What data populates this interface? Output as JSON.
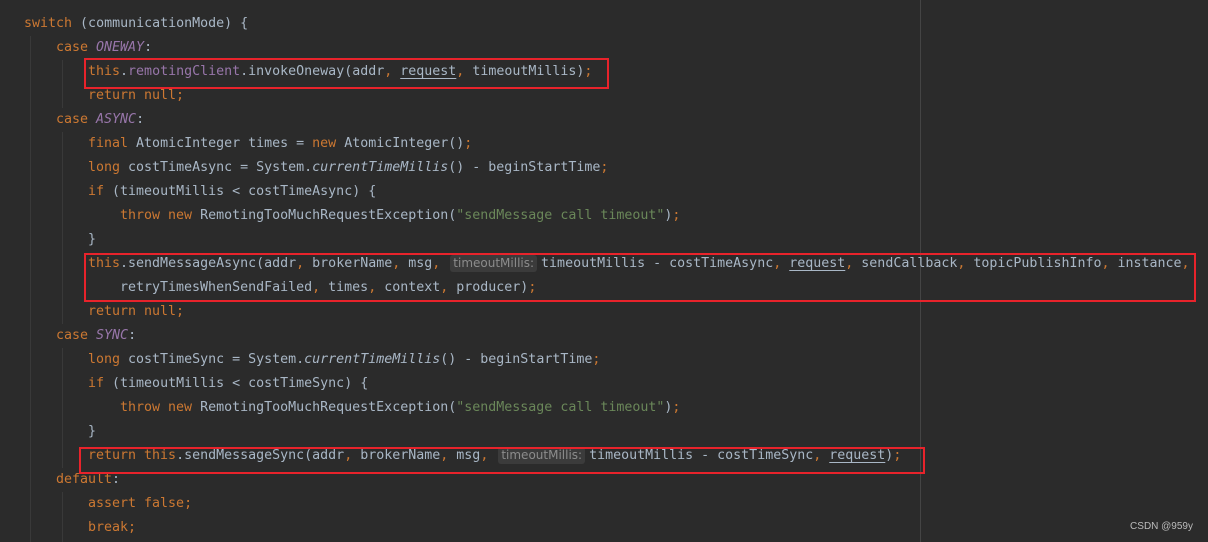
{
  "colors": {
    "background": "#2b2b2b",
    "keyword": "#cc7832",
    "constant": "#9876aa",
    "string": "#6a8759",
    "text": "#a9b7c6",
    "highlight_box": "#e8232b"
  },
  "code": {
    "lines": [
      {
        "indent": 0,
        "tokens": [
          [
            "switch",
            "kw"
          ],
          [
            " (communicationMode) {",
            ""
          ]
        ]
      },
      {
        "indent": 1,
        "tokens": [
          [
            "case ",
            "kw"
          ],
          [
            "ONEWAY",
            "const"
          ],
          [
            ":",
            ""
          ]
        ]
      },
      {
        "indent": 2,
        "tokens": [
          [
            "this",
            "kw"
          ],
          [
            ".",
            ""
          ],
          [
            "remotingClient",
            "field"
          ],
          [
            ".invokeOneway(addr",
            ""
          ],
          [
            ", ",
            "kw"
          ],
          [
            "request",
            "ul"
          ],
          [
            ", ",
            "kw"
          ],
          [
            "timeoutMillis)",
            ""
          ],
          [
            ";",
            "kw"
          ]
        ]
      },
      {
        "indent": 2,
        "tokens": [
          [
            "return null;",
            "kw"
          ]
        ]
      },
      {
        "indent": 1,
        "tokens": [
          [
            "case ",
            "kw"
          ],
          [
            "ASYNC",
            "const"
          ],
          [
            ":",
            ""
          ]
        ]
      },
      {
        "indent": 2,
        "tokens": [
          [
            "final ",
            "kw"
          ],
          [
            "AtomicInteger times = ",
            ""
          ],
          [
            "new ",
            "kw"
          ],
          [
            "AtomicInteger()",
            ""
          ],
          [
            ";",
            "kw"
          ]
        ]
      },
      {
        "indent": 2,
        "tokens": [
          [
            "long ",
            "kw"
          ],
          [
            "costTimeAsync = System.",
            ""
          ],
          [
            "currentTimeMillis",
            "ital"
          ],
          [
            "() - beginStartTime",
            ""
          ],
          [
            ";",
            "kw"
          ]
        ]
      },
      {
        "indent": 2,
        "tokens": [
          [
            "if ",
            "kw"
          ],
          [
            "(timeoutMillis < costTimeAsync) {",
            ""
          ]
        ]
      },
      {
        "indent": 3,
        "tokens": [
          [
            "throw new ",
            "kw"
          ],
          [
            "RemotingTooMuchRequestException(",
            ""
          ],
          [
            "\"sendMessage call timeout\"",
            "str"
          ],
          [
            ")",
            ""
          ],
          [
            ";",
            "kw"
          ]
        ]
      },
      {
        "indent": 2,
        "tokens": [
          [
            "}",
            ""
          ]
        ]
      },
      {
        "indent": 2,
        "tokens": [
          [
            "this",
            "kw"
          ],
          [
            ".sendMessageAsync(addr",
            ""
          ],
          [
            ", ",
            "kw"
          ],
          [
            "brokerName",
            ""
          ],
          [
            ", ",
            "kw"
          ],
          [
            "msg",
            ""
          ],
          [
            ", ",
            "kw"
          ],
          [
            "timeoutMillis:",
            "hint"
          ],
          [
            "timeoutMillis - costTimeAsync",
            ""
          ],
          [
            ", ",
            "kw"
          ],
          [
            "request",
            "ul"
          ],
          [
            ", ",
            "kw"
          ],
          [
            "sendCallback",
            ""
          ],
          [
            ", ",
            "kw"
          ],
          [
            "topicPublishInfo",
            ""
          ],
          [
            ", ",
            "kw"
          ],
          [
            "instance",
            ""
          ],
          [
            ",",
            "kw"
          ]
        ]
      },
      {
        "indent": 3,
        "tokens": [
          [
            "retryTimesWhenSendFailed",
            ""
          ],
          [
            ", ",
            "kw"
          ],
          [
            "times",
            ""
          ],
          [
            ", ",
            "kw"
          ],
          [
            "context",
            ""
          ],
          [
            ", ",
            "kw"
          ],
          [
            "producer)",
            ""
          ],
          [
            ";",
            "kw"
          ]
        ]
      },
      {
        "indent": 2,
        "tokens": [
          [
            "return null;",
            "kw"
          ]
        ]
      },
      {
        "indent": 1,
        "tokens": [
          [
            "case ",
            "kw"
          ],
          [
            "SYNC",
            "const"
          ],
          [
            ":",
            ""
          ]
        ]
      },
      {
        "indent": 2,
        "tokens": [
          [
            "long ",
            "kw"
          ],
          [
            "costTimeSync = System.",
            ""
          ],
          [
            "currentTimeMillis",
            "ital"
          ],
          [
            "() - beginStartTime",
            ""
          ],
          [
            ";",
            "kw"
          ]
        ]
      },
      {
        "indent": 2,
        "tokens": [
          [
            "if ",
            "kw"
          ],
          [
            "(timeoutMillis < costTimeSync) {",
            ""
          ]
        ]
      },
      {
        "indent": 3,
        "tokens": [
          [
            "throw new ",
            "kw"
          ],
          [
            "RemotingTooMuchRequestException(",
            ""
          ],
          [
            "\"sendMessage call timeout\"",
            "str"
          ],
          [
            ")",
            ""
          ],
          [
            ";",
            "kw"
          ]
        ]
      },
      {
        "indent": 2,
        "tokens": [
          [
            "}",
            ""
          ]
        ]
      },
      {
        "indent": 2,
        "tokens": [
          [
            "return this",
            "kw"
          ],
          [
            ".sendMessageSync(addr",
            ""
          ],
          [
            ", ",
            "kw"
          ],
          [
            "brokerName",
            ""
          ],
          [
            ", ",
            "kw"
          ],
          [
            "msg",
            ""
          ],
          [
            ", ",
            "kw"
          ],
          [
            "timeoutMillis:",
            "hint"
          ],
          [
            "timeoutMillis - costTimeSync",
            ""
          ],
          [
            ", ",
            "kw"
          ],
          [
            "request",
            "ul"
          ],
          [
            ")",
            ""
          ],
          [
            ";",
            "kw"
          ]
        ]
      },
      {
        "indent": 1,
        "tokens": [
          [
            "default",
            "kw"
          ],
          [
            ":",
            ""
          ]
        ]
      },
      {
        "indent": 2,
        "tokens": [
          [
            "assert false;",
            "kw"
          ]
        ]
      },
      {
        "indent": 2,
        "tokens": [
          [
            "break;",
            "kw"
          ]
        ]
      }
    ]
  },
  "watermark": "CSDN @959y"
}
